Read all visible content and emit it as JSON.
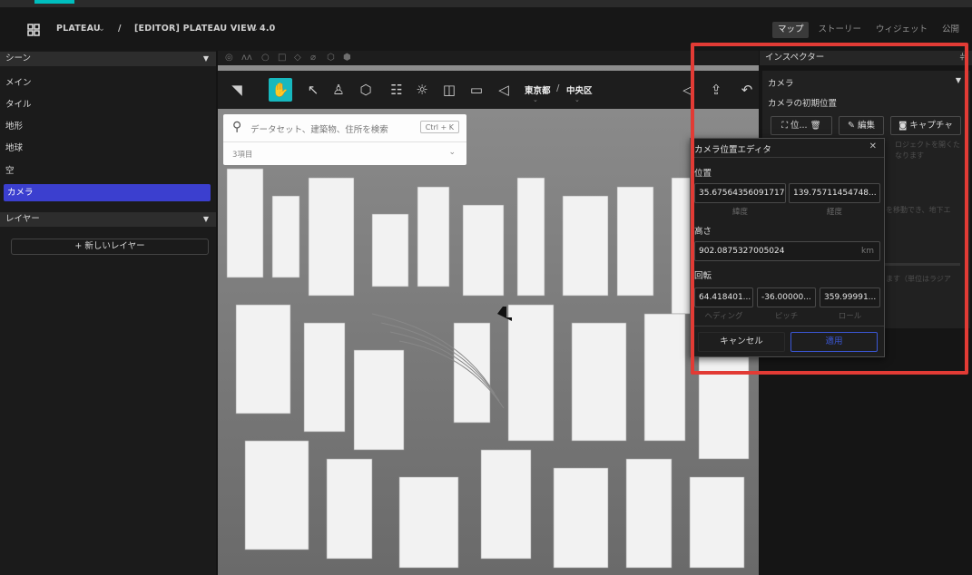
{
  "header": {
    "project": "PLATEAU",
    "separator": "/",
    "editor_title": "[EDITOR] PLATEAU VIEW 4.0",
    "nav": [
      "マップ",
      "ストーリー",
      "ウィジェット",
      "公開"
    ]
  },
  "left_panel": {
    "scene_header": "シーン",
    "scene_items": [
      "メイン",
      "タイル",
      "地形",
      "地球",
      "空",
      "カメラ"
    ],
    "layer_header": "レイヤー",
    "new_layer_label": "+ 新しいレイヤー"
  },
  "toolbar": {
    "prefecture": "東京都",
    "separator": "/",
    "ward": "中央区"
  },
  "search": {
    "placeholder": "データセット、建築物、住所を検索",
    "shortcut": "Ctrl + K",
    "count": "3項目"
  },
  "inspector": {
    "header": "インスペクター",
    "section": "カメラ",
    "subtitle": "カメラの初期位置",
    "position_btn": "位...",
    "edit_btn": "編集",
    "capture_btn": "キャプチャ",
    "hidden_text_1": "ロジェクトを開くた",
    "hidden_text_2": "なります",
    "hidden_text_3": "を移動でき、地下エ",
    "hidden_text_4": "ます（単位はラジア"
  },
  "editor": {
    "title": "カメラ位置エディタ",
    "position_label": "位置",
    "latitude": "35.67564356091717",
    "longitude": "139.75711454748...",
    "latitude_label": "緯度",
    "longitude_label": "経度",
    "height_label": "高さ",
    "height_value": "902.0875327005024",
    "height_unit": "km",
    "rotation_label": "回転",
    "heading": "64.418401...",
    "pitch": "-36.00000...",
    "roll": "359.99991...",
    "heading_label": "ヘディング",
    "pitch_label": "ピッチ",
    "roll_label": "ロール",
    "cancel": "キャンセル",
    "apply": "適用"
  },
  "colors": {
    "accent_teal": "#17b8be",
    "selected_blue": "#3b3fcf",
    "highlight_red": "#e23b35"
  }
}
